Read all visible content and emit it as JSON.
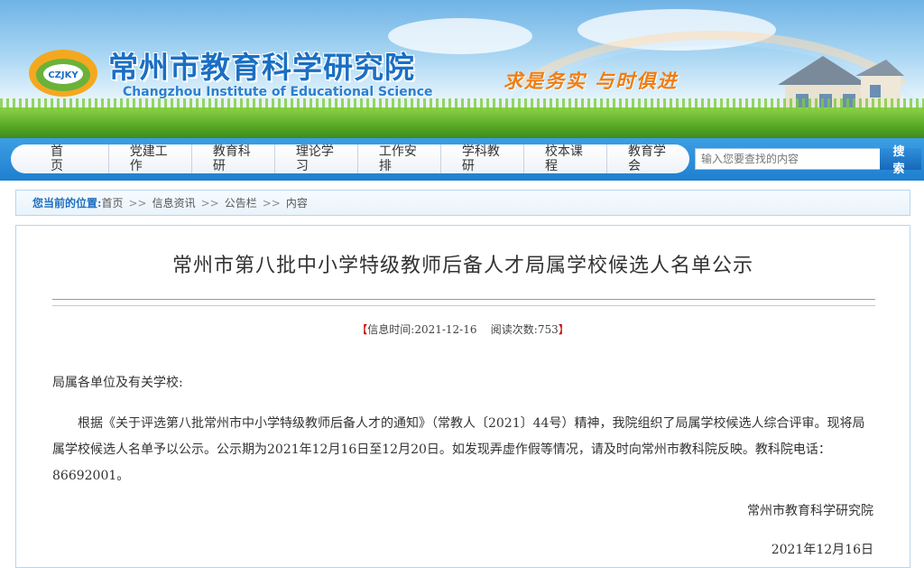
{
  "banner": {
    "logo_text": "CZJKY",
    "title": "常州市教育科学研究院",
    "subtitle": "Changzhou Institute of Educational Science",
    "slogan": "求是务实  与时俱进"
  },
  "nav": {
    "items": [
      {
        "label": "首　页"
      },
      {
        "label": "党建工作"
      },
      {
        "label": "教育科研"
      },
      {
        "label": "理论学习"
      },
      {
        "label": "工作安排"
      },
      {
        "label": "学科教研"
      },
      {
        "label": "校本课程"
      },
      {
        "label": "教育学会"
      }
    ],
    "search_placeholder": "输入您要查找的内容",
    "search_button": "搜 索"
  },
  "breadcrumb": {
    "label": "您当前的位置:",
    "items": [
      "首页",
      "信息资讯",
      "公告栏",
      "内容"
    ],
    "separator": ">>"
  },
  "article": {
    "title": "常州市第八批中小学特级教师后备人才局属学校候选人名单公示",
    "meta_open": "【",
    "meta_time_label": "信息时间:",
    "meta_time": "2021-12-16",
    "meta_reads_label": "阅读次数:",
    "meta_reads": "753",
    "meta_close": "】",
    "salutation": "局属各单位及有关学校:",
    "paragraph": "根据《关于评选第八批常州市中小学特级教师后备人才的通知》（常教人〔2021〕44号）精神，我院组织了局属学校候选人综合评审。现将局属学校候选人名单予以公示。公示期为2021年12月16日至12月20日。如发现弄虚作假等情况，请及时向常州市教科院反映。教科院电话：86692001。",
    "signature_org": "常州市教育科学研究院",
    "signature_date": "2021年12月16日"
  },
  "colors": {
    "nav_blue": "#1e7fcf",
    "title_blue": "#1a6fc4",
    "slogan_orange": "#f07d12",
    "crumb_label": "#1d6fc0"
  }
}
